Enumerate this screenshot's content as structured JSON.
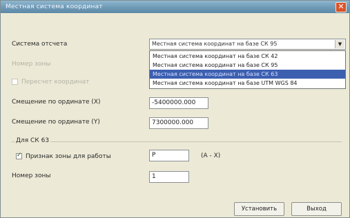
{
  "window": {
    "title": "Местная система координат",
    "close_glyph": "✕"
  },
  "system": {
    "label": "Система отсчета",
    "selected": "Местная система координат на базе СК 95",
    "options": [
      "Местная система координат на базе СК 42",
      "Местная система координат на базе СК 95",
      "Местная система координат на базе СК 63",
      "Местная система координат на базе UTM WGS 84"
    ],
    "highlighted_index": 2
  },
  "disabled": {
    "label1": "Номер зоны",
    "checkbox_label": "Пересчет координат"
  },
  "offset_x": {
    "label": "Смещение по ординате (X)",
    "value": "-5400000.000"
  },
  "offset_y": {
    "label": "Смещение по ординате (Y)",
    "value": "7300000.000"
  },
  "sk63": {
    "group_label": "Для СК 63",
    "use_letter_label": "Признак зоны для работы",
    "letter_value": "P",
    "letter_range": "(A - X)",
    "letter_checked": true,
    "zone_label": "Номер зоны",
    "zone_value": "1"
  },
  "buttons": {
    "ok": "Установить",
    "cancel": "Выход"
  },
  "colors": {
    "title_bar": "#6e9ab6",
    "selection": "#3d5fb0",
    "close": "#d9542b"
  }
}
